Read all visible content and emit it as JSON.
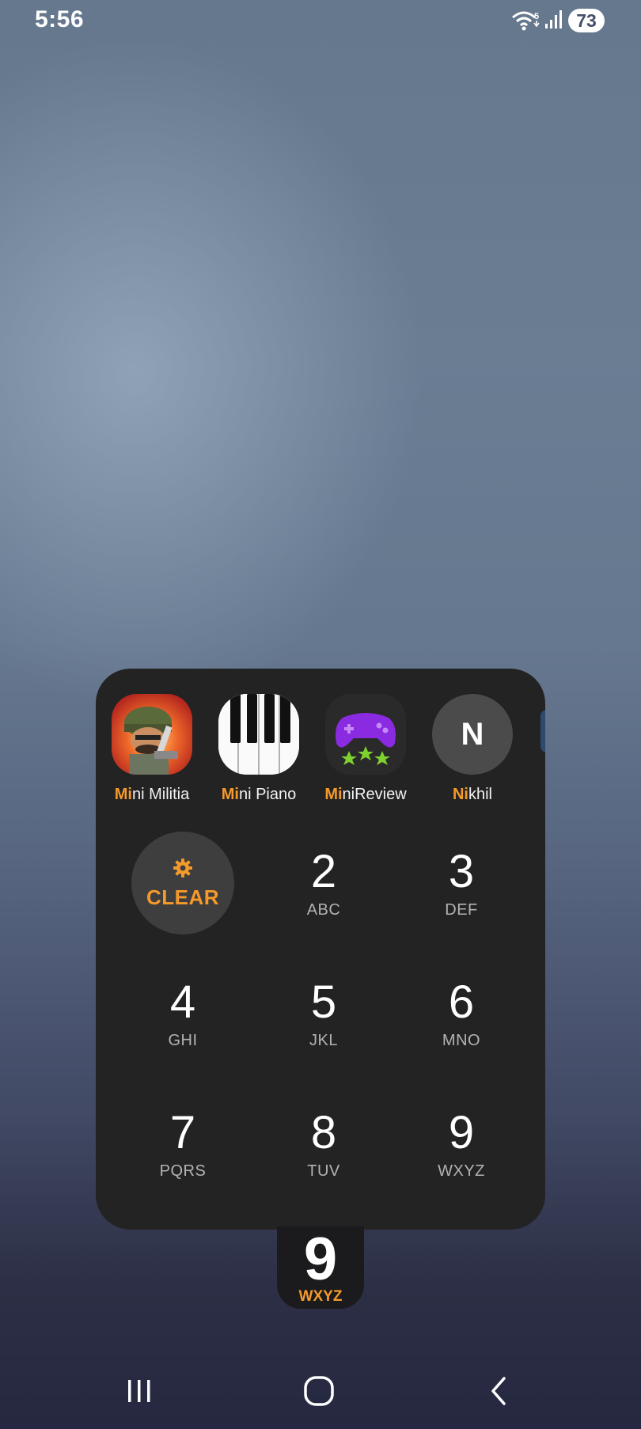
{
  "status_bar": {
    "time": "5:56",
    "wifi_badge": "5",
    "battery_level": "73",
    "icons": [
      "wifi-icon",
      "signal-icon",
      "battery-icon"
    ]
  },
  "search_results": [
    {
      "highlight": "Mi",
      "rest": "ni Militia",
      "icon": "mini-militia-icon",
      "type": "app"
    },
    {
      "highlight": "Mi",
      "rest": "ni Piano",
      "icon": "piano-icon",
      "type": "app"
    },
    {
      "highlight": "Mi",
      "rest": "niReview",
      "icon": "gamepad-icon",
      "type": "app"
    },
    {
      "highlight": "Ni",
      "rest": "khil",
      "icon": "contact-avatar",
      "type": "contact",
      "initial": "N"
    }
  ],
  "keypad": {
    "clear_label": "CLEAR",
    "keys": [
      {
        "digit": "2",
        "letters": "ABC"
      },
      {
        "digit": "3",
        "letters": "DEF"
      },
      {
        "digit": "4",
        "letters": "GHI"
      },
      {
        "digit": "5",
        "letters": "JKL"
      },
      {
        "digit": "6",
        "letters": "MNO"
      },
      {
        "digit": "7",
        "letters": "PQRS"
      },
      {
        "digit": "8",
        "letters": "TUV"
      },
      {
        "digit": "9",
        "letters": "WXYZ"
      }
    ]
  },
  "floating_key": {
    "digit": "9",
    "letters": "WXYZ"
  },
  "colors": {
    "accent": "#f59a2a",
    "panel": "#232323",
    "key_letters": "#b3b3b3"
  },
  "nav_bar": {
    "buttons": [
      "recents-icon",
      "home-icon",
      "back-icon"
    ]
  }
}
